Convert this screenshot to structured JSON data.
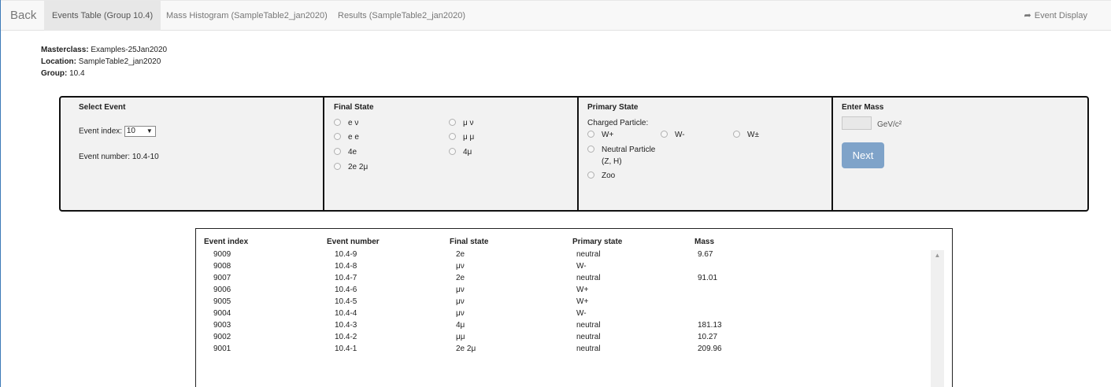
{
  "nav": {
    "back": "Back",
    "tabs": [
      {
        "label": "Events Table (Group 10.4)",
        "active": true
      },
      {
        "label": "Mass Histogram (SampleTable2_jan2020)",
        "active": false
      },
      {
        "label": "Results (SampleTable2_jan2020)",
        "active": false
      }
    ],
    "event_display": "Event Display",
    "event_display_icon": "share-icon"
  },
  "info": {
    "masterclass_label": "Masterclass:",
    "masterclass_value": "Examples-25Jan2020",
    "location_label": "Location:",
    "location_value": "SampleTable2_jan2020",
    "group_label": "Group:",
    "group_value": "10.4"
  },
  "select_event": {
    "title": "Select Event",
    "index_label": "Event index:",
    "index_value": "10",
    "number_label": "Event number:",
    "number_value": "10.4-10"
  },
  "final_state": {
    "title": "Final State",
    "options": [
      "e ν",
      "μ ν",
      "e e",
      "μ μ",
      "4e",
      "4μ",
      "2e 2μ"
    ]
  },
  "primary_state": {
    "title": "Primary State",
    "charged_label": "Charged Particle:",
    "charged_options": [
      "W+",
      "W-",
      "W±"
    ],
    "neutral_label": "Neutral Particle",
    "neutral_sub": "(Z, H)",
    "zoo_label": "Zoo"
  },
  "enter_mass": {
    "title": "Enter Mass",
    "input_value": "",
    "unit": "GeV/c²",
    "next_label": "Next"
  },
  "table": {
    "headers": [
      "Event index",
      "Event number",
      "Final state",
      "Primary state",
      "Mass"
    ],
    "rows": [
      [
        "9009",
        "10.4-9",
        "2e",
        "neutral",
        "9.67"
      ],
      [
        "9008",
        "10.4-8",
        "μν",
        "W-",
        ""
      ],
      [
        "9007",
        "10.4-7",
        "2e",
        "neutral",
        "91.01"
      ],
      [
        "9006",
        "10.4-6",
        "μν",
        "W+",
        ""
      ],
      [
        "9005",
        "10.4-5",
        "μν",
        "W+",
        ""
      ],
      [
        "9004",
        "10.4-4",
        "μν",
        "W-",
        ""
      ],
      [
        "9003",
        "10.4-3",
        "4μ",
        "neutral",
        "181.13"
      ],
      [
        "9002",
        "10.4-2",
        "μμ",
        "neutral",
        "10.27"
      ],
      [
        "9001",
        "10.4-1",
        "2e 2μ",
        "neutral",
        "209.96"
      ]
    ]
  }
}
